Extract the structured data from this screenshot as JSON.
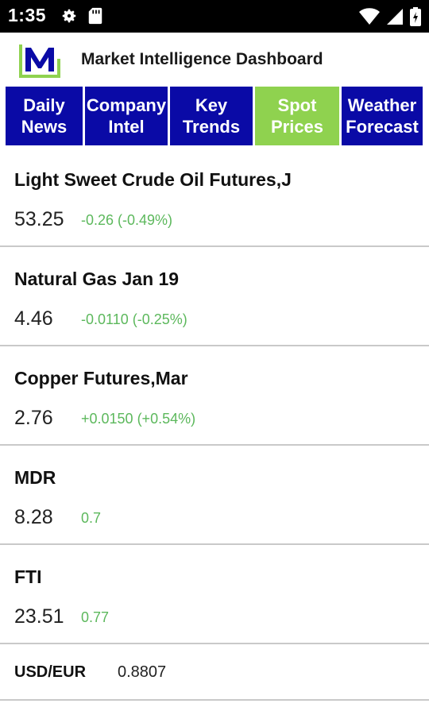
{
  "status_bar": {
    "time": "1:35",
    "icons_left": [
      "gear-icon",
      "sd-card-icon"
    ],
    "icons_right": [
      "wifi-icon",
      "cell-signal-icon",
      "battery-icon"
    ]
  },
  "header": {
    "logo_letter": "M",
    "title": "Market Intelligence Dashboard",
    "logo_color": "#0a0aa6",
    "logo_accent": "#8fd24f"
  },
  "tabs": [
    {
      "line1": "Daily",
      "line2": "News",
      "active": false
    },
    {
      "line1": "Company",
      "line2": "Intel",
      "active": false
    },
    {
      "line1": "Key",
      "line2": "Trends",
      "active": false
    },
    {
      "line1": "Spot",
      "line2": "Prices",
      "active": true
    },
    {
      "line1": "Weather",
      "line2": "Forecast",
      "active": false
    }
  ],
  "colors": {
    "tab_bg": "#0a0aa6",
    "tab_active_bg": "#8fd24f",
    "change_color": "#5cb85c"
  },
  "items": [
    {
      "name": "Light Sweet Crude Oil Futures,J",
      "price": "53.25",
      "change": "-0.26 (-0.49%)"
    },
    {
      "name": "Natural Gas Jan 19",
      "price": "4.46",
      "change": "-0.0110 (-0.25%)"
    },
    {
      "name": "Copper Futures,Mar",
      "price": "2.76",
      "change": "+0.0150 (+0.54%)"
    },
    {
      "name": "MDR",
      "price": "8.28",
      "change": "0.7"
    },
    {
      "name": "FTI",
      "price": "23.51",
      "change": "0.77"
    }
  ],
  "fx": {
    "label": "USD/EUR",
    "value": "0.8807"
  }
}
